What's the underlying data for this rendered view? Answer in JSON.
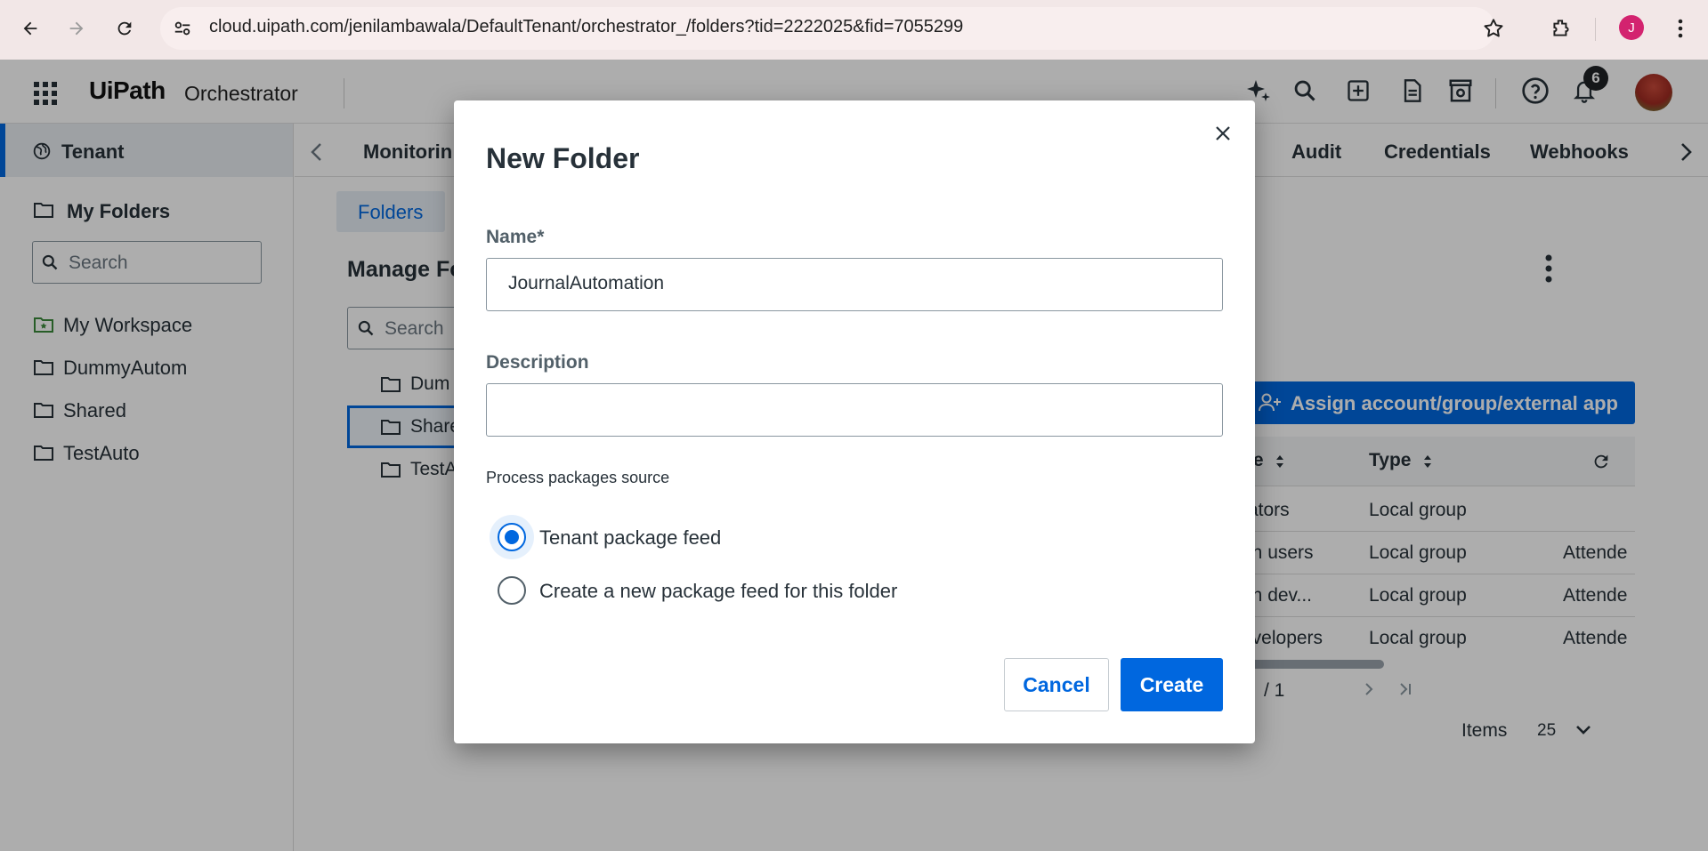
{
  "browser": {
    "url": "cloud.uipath.com/jenilambawala/DefaultTenant/orchestrator_/folders?tid=2222025&fid=7055299",
    "profile_initial": "J"
  },
  "header": {
    "logo": "UiPath",
    "product": "Orchestrator",
    "notification_count": "6"
  },
  "sidebar": {
    "tenant_label": "Tenant",
    "my_folders_label": "My Folders",
    "search_placeholder": "Search",
    "items": [
      {
        "label": "My Workspace",
        "icon": "workspace-folder-icon"
      },
      {
        "label": "DummyAutom",
        "icon": "folder-icon"
      },
      {
        "label": "Shared",
        "icon": "folder-icon"
      },
      {
        "label": "TestAuto",
        "icon": "folder-icon"
      }
    ]
  },
  "main": {
    "tabs": [
      "Monitorin",
      "Audit",
      "Credentials",
      "Webhooks"
    ],
    "subtab": "Folders",
    "title": "Manage Fo",
    "search_placeholder": "Search",
    "tree": [
      "Dum",
      "Share",
      "TestA"
    ],
    "assign_button": "Assign account/group/external app",
    "table": {
      "headers": [
        "ne",
        "Type"
      ],
      "rows": [
        [
          "rators",
          "Local group",
          ""
        ],
        [
          "on users",
          "Local group",
          "Attende"
        ],
        [
          "on dev...",
          "Local group",
          "Attende"
        ],
        [
          "evelopers",
          "Local group",
          "Attende"
        ]
      ]
    },
    "pager": {
      "page_of": "/ 1",
      "items_label": "Items",
      "items_value": "25"
    }
  },
  "dialog": {
    "title": "New Folder",
    "name_label": "Name*",
    "name_value": "JournalAutomation",
    "description_label": "Description",
    "description_value": "",
    "source_label": "Process packages source",
    "options": [
      {
        "label": "Tenant package feed",
        "checked": true
      },
      {
        "label": "Create a new package feed for this folder",
        "checked": false
      }
    ],
    "cancel_label": "Cancel",
    "create_label": "Create"
  },
  "colors": {
    "accent": "#0067df",
    "text": "#273139",
    "overlay": "rgba(0,0,0,0.32)"
  }
}
